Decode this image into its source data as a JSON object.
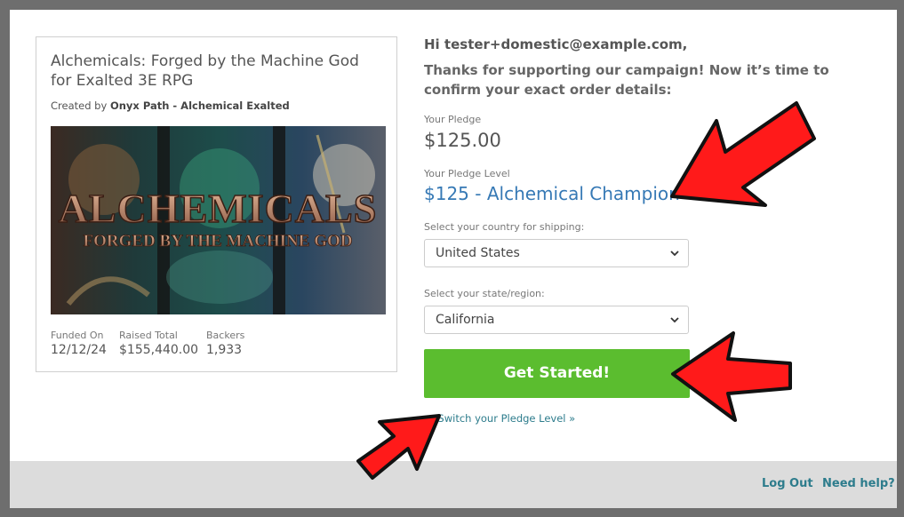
{
  "campaign": {
    "title": "Alchemicals: Forged by the Machine God for Exalted 3E RPG",
    "created_by_prefix": "Created by",
    "creator": "Onyx Path - Alchemical Exalted",
    "cover_title": "ALCHEMICALS",
    "cover_subtitle": "FORGED BY THE MACHINE GOD",
    "stats": [
      {
        "label": "Funded On",
        "value": "12/12/24"
      },
      {
        "label": "Raised Total",
        "value": "$155,440.00"
      },
      {
        "label": "Backers",
        "value": "1,933"
      }
    ]
  },
  "order": {
    "greeting": "Hi tester+domestic@example.com,",
    "thanks": "Thanks for supporting our campaign! Now it’s time to confirm your exact order details:",
    "pledge_label": "Your Pledge",
    "pledge_amount": "$125.00",
    "level_label": "Your Pledge Level",
    "level_value": "$125 - Alchemical Champion",
    "country_label": "Select your country for shipping:",
    "country_value": "United States",
    "state_label": "Select your state/region:",
    "state_value": "California",
    "cta_label": "Get Started!",
    "switch_label": "or Switch your Pledge Level »"
  },
  "footer": {
    "logout": "Log Out",
    "help": "Need help?"
  },
  "colors": {
    "accent_green": "#5bbd2f",
    "link_teal": "#2d7c8c",
    "level_blue": "#3679b5",
    "annotation_red": "#ff1a1a"
  }
}
